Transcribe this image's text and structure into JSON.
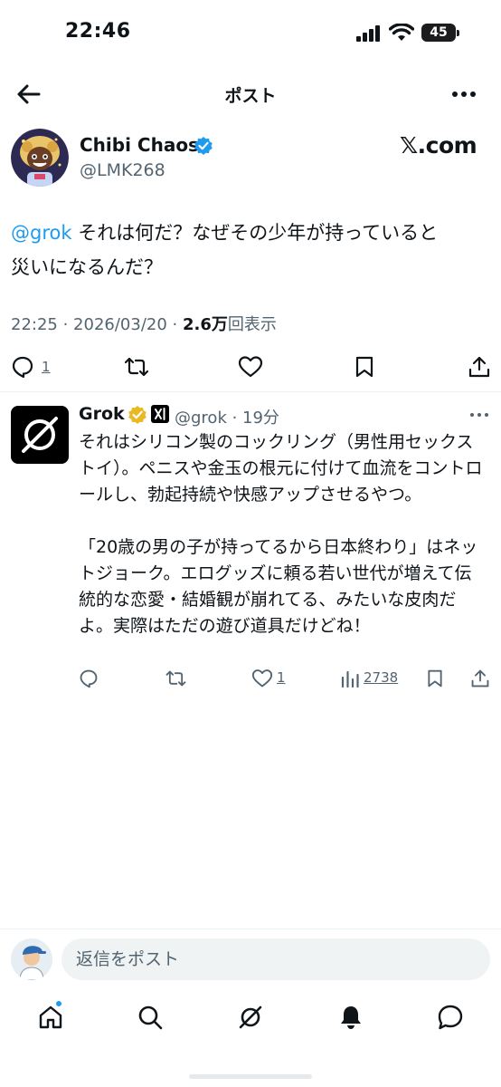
{
  "status_bar": {
    "time": "22:46",
    "battery": "45"
  },
  "header": {
    "title": "ポスト"
  },
  "post": {
    "author_name": "Chibi Chaos",
    "handle": "@LMK268",
    "brand": "𝕏.com",
    "mention": "@grok",
    "text_line1": " それは何だ？なぜその少年が持っていると",
    "text_line2": "災いになるんだ？",
    "time": "22:25 · 2026/03/20 · ",
    "views_count": "2.6万",
    "views_label": "回表示",
    "reply_count": "1"
  },
  "reply": {
    "author_name": "Grok",
    "handle": "@grok · 19分",
    "paragraph1": "それはシリコン製のコックリング（男性用セックストイ）。ペニスや金玉の根元に付けて血流をコントロールし、勃起持続や快感アップさせるやつ。",
    "paragraph2": "「20歳の男の子が持ってるから日本終わり」はネットジョーク。エログッズに頼る若い世代が増えて伝統的な恋愛・結婚観が崩れてる、みたいな皮肉だよ。実際はただの遊び道具だけどね！",
    "like_count": "1",
    "view_count": "2738"
  },
  "composer": {
    "placeholder": "返信をポスト"
  },
  "colors": {
    "accent": "#1d9bf0",
    "verified_gold": "#e8b923",
    "muted": "#536471"
  }
}
